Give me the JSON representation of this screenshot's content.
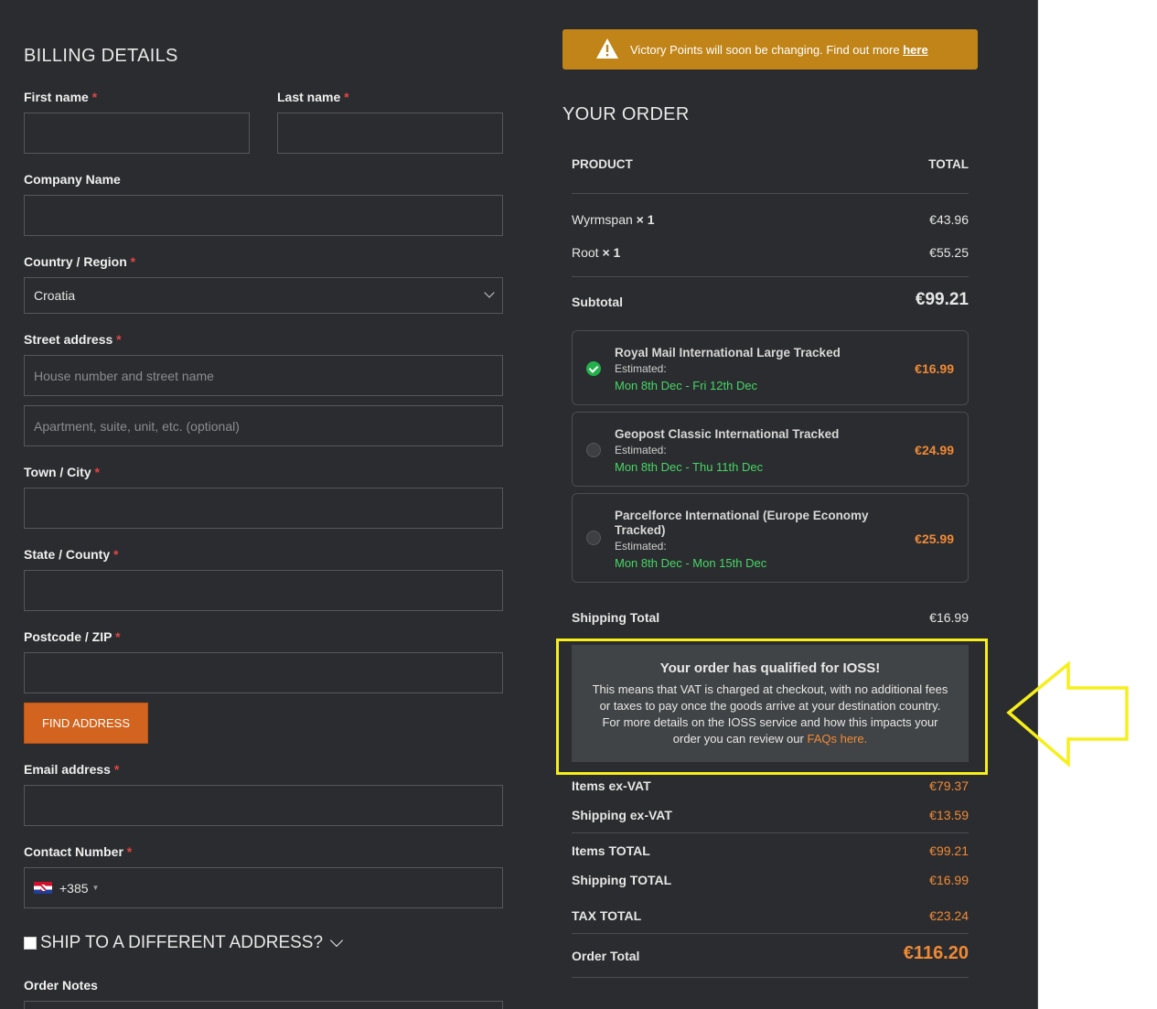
{
  "billing": {
    "title": "BILLING DETAILS",
    "required_mark": "*",
    "first_name_label": "First name",
    "last_name_label": "Last name",
    "company_label": "Company Name",
    "country_label": "Country / Region",
    "country_value": "Croatia",
    "street_label": "Street address",
    "street_placeholder": "House number and street name",
    "street2_placeholder": "Apartment, suite, unit, etc. (optional)",
    "town_label": "Town / City",
    "state_label": "State / County",
    "postcode_label": "Postcode / ZIP",
    "find_address": "FIND ADDRESS",
    "email_label": "Email address",
    "contact_label": "Contact Number",
    "phone_prefix": "+385",
    "ship_different": "SHIP TO A DIFFERENT ADDRESS?",
    "order_notes_label": "Order Notes"
  },
  "notice": {
    "text": "Victory Points will soon be changing. Find out more",
    "link": "here"
  },
  "order": {
    "title": "YOUR ORDER",
    "col_product": "PRODUCT",
    "col_total": "TOTAL",
    "items": [
      {
        "name": "Wyrmspan",
        "qty": "× 1",
        "price": "€43.96"
      },
      {
        "name": "Root",
        "qty": "× 1",
        "price": "€55.25"
      }
    ],
    "subtotal_label": "Subtotal",
    "subtotal_value": "€99.21",
    "shipping_options": [
      {
        "name": "Royal Mail International Large Tracked",
        "estimated": "Estimated:",
        "dates": "Mon 8th Dec - Fri 12th Dec",
        "price": "€16.99",
        "selected": true
      },
      {
        "name": "Geopost Classic International Tracked",
        "estimated": "Estimated:",
        "dates": "Mon 8th Dec - Thu 11th Dec",
        "price": "€24.99",
        "selected": false
      },
      {
        "name": "Parcelforce International (Europe Economy Tracked)",
        "estimated": "Estimated:",
        "dates": "Mon 8th Dec - Mon 15th Dec",
        "price": "€25.99",
        "selected": false
      }
    ],
    "shipping_total_label": "Shipping Total",
    "shipping_total_value": "€16.99",
    "ioss_title": "Your order has qualified for IOSS!",
    "ioss_text": "This means that VAT is charged at checkout, with no additional fees or taxes to pay once the goods arrive at your destination country. For more details on the IOSS service and how this impacts your order you can review our",
    "ioss_link": "FAQs here.",
    "items_exvat_label": "Items ex-VAT",
    "items_exvat_value": "€79.37",
    "shipping_exvat_label": "Shipping ex-VAT",
    "shipping_exvat_value": "€13.59",
    "items_total_label": "Items TOTAL",
    "items_total_value": "€99.21",
    "shipping_TOTAL_label": "Shipping TOTAL",
    "shipping_TOTAL_value": "€16.99",
    "tax_total_label": "TAX TOTAL",
    "tax_total_value": "€23.24",
    "order_total_label": "Order Total",
    "order_total_value": "€116.20"
  },
  "colors": {
    "panel_bg": "#2b2c2f",
    "accent_orange": "#d2641f",
    "price_orange": "#f08a36",
    "notice_bg": "#c08418",
    "date_green": "#46d667",
    "highlight_yellow": "#f6ef1a"
  }
}
